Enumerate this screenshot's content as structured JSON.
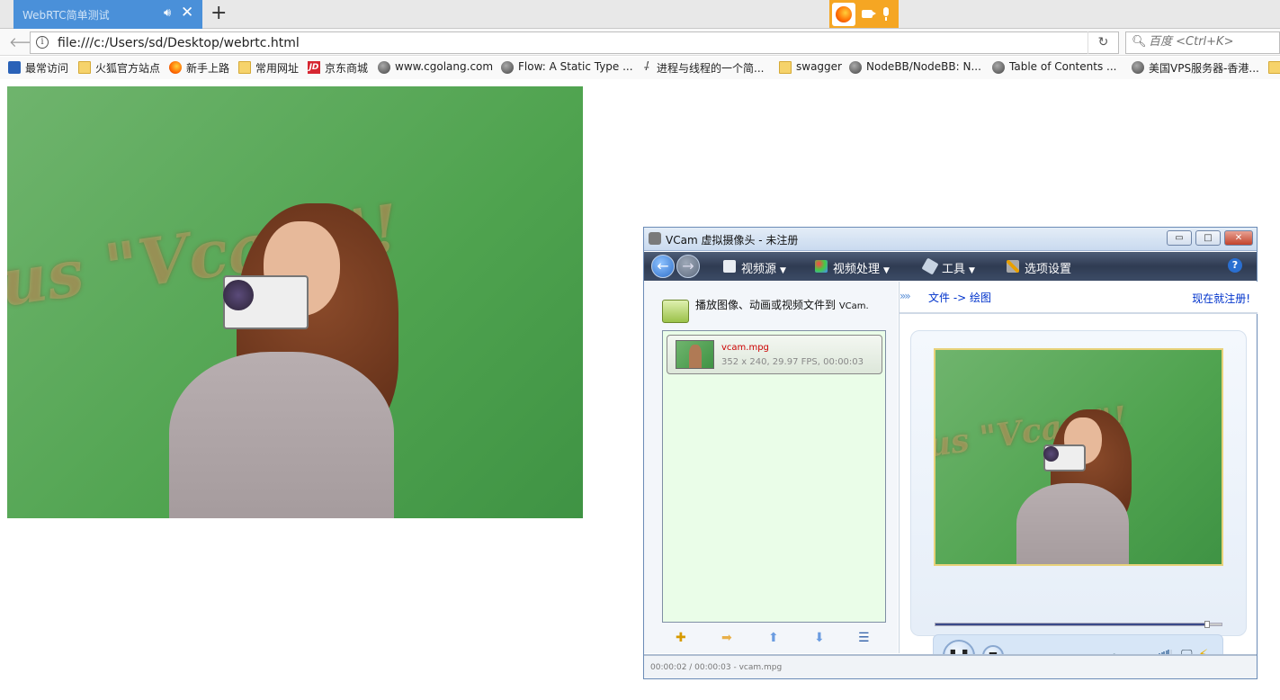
{
  "browser": {
    "tab_title": "WebRTC简单测试",
    "tab_audio_icon": "speaker-icon",
    "tab_close": "✕",
    "new_tab": "+",
    "url": "file:///c:/Users/sd/Desktop/webrtc.html",
    "search_placeholder": "百度 <Ctrl+K>",
    "sharing_indicators": [
      "firefox-icon",
      "camera-icon",
      "microphone-icon"
    ],
    "accent_color": "#4a90d9",
    "sharing_color": "#f5a623"
  },
  "bookmarks": [
    {
      "label": "最常访问",
      "icon": "frequent-icon"
    },
    {
      "label": "火狐官方站点",
      "icon": "folder-icon"
    },
    {
      "label": "新手上路",
      "icon": "firefox-icon"
    },
    {
      "label": "常用网址",
      "icon": "folder-icon"
    },
    {
      "label": "京东商城",
      "icon": "jd-icon"
    },
    {
      "label": "www.cgolang.com",
      "icon": "globe-icon"
    },
    {
      "label": "Flow: A Static Type ...",
      "icon": "globe-icon"
    },
    {
      "label": "进程与线程的一个简...",
      "icon": "dagger-icon"
    },
    {
      "label": "swagger",
      "icon": "folder-icon"
    },
    {
      "label": "NodeBB/NodeBB: N...",
      "icon": "globe-icon"
    },
    {
      "label": "Table of Contents ...",
      "icon": "globe-icon"
    },
    {
      "label": "美国VPS服务器-香港...",
      "icon": "globe-icon"
    }
  ],
  "page": {
    "video_watermark": "us \"Vcam\"!"
  },
  "vcam": {
    "title": "VCam 虚拟摄像头 - 未注册",
    "window_buttons": {
      "minimize": "▭",
      "maximize": "□",
      "close": "✕"
    },
    "menu": [
      {
        "label": "视频源",
        "icon": "document-icon"
      },
      {
        "label": "视频处理",
        "icon": "color-balls-icon"
      },
      {
        "label": "工具",
        "icon": "tag-icon"
      },
      {
        "label": "选项设置",
        "icon": "wrench-icon"
      }
    ],
    "help": "?",
    "left_header": "播放图像、动画或视频文件到 ",
    "left_header_small": "VCam.",
    "file": {
      "name": "vcam.mpg",
      "meta": "352 x 240, 29.97 FPS, 00:00:03"
    },
    "list_buttons": [
      "add-file-icon",
      "add-folder-icon",
      "move-up-icon",
      "move-down-icon",
      "list-menu-icon"
    ],
    "breadcrumb_arrows": "»»",
    "breadcrumb": "文件 -> 绘图",
    "register_link": "现在就注册!",
    "preview_watermark": "us \"Vcam\"!",
    "playback_progress": 0.95,
    "volume_level": 0.9,
    "controls": {
      "pause": "❚❚",
      "stop": "■",
      "mute": "🔈",
      "monitor": "🖵",
      "turbo": "⚡"
    },
    "status": "00:00:02 / 00:00:03 - vcam.mpg"
  }
}
